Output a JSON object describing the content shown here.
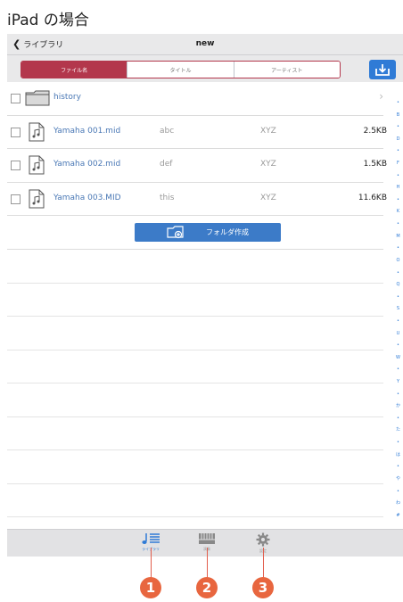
{
  "page": {
    "heading": "iPad の場合"
  },
  "navbar": {
    "back_label": "ライブラリ",
    "title": "new"
  },
  "segments": [
    {
      "label": "ファイル名",
      "selected": true
    },
    {
      "label": "タイトル",
      "selected": false
    },
    {
      "label": "アーティスト",
      "selected": false
    }
  ],
  "list": {
    "folder": {
      "name": "history"
    },
    "files": [
      {
        "name": "Yamaha 001.mid",
        "title": "abc",
        "artist": "XYZ",
        "size": "2.5KB"
      },
      {
        "name": "Yamaha 002.mid",
        "title": "def",
        "artist": "XYZ",
        "size": "1.5KB"
      },
      {
        "name": "Yamaha 003.MID",
        "title": "this",
        "artist": "XYZ",
        "size": "11.6KB"
      }
    ],
    "new_folder_label": "フォルダ作成"
  },
  "index_bar": [
    "•",
    "B",
    "•",
    "D",
    "•",
    "F",
    "•",
    "H",
    "•",
    "K",
    "•",
    "M",
    "•",
    "O",
    "•",
    "Q",
    "•",
    "S",
    "•",
    "U",
    "•",
    "W",
    "•",
    "Y",
    "•",
    "か",
    "•",
    "た",
    "•",
    "は",
    "•",
    "や",
    "•",
    "わ",
    "#"
  ],
  "tabbar": {
    "tabs": [
      {
        "label": "ライブラリ",
        "icon": "library-icon",
        "active": true
      },
      {
        "label": "演奏",
        "icon": "keyboard-icon",
        "active": false
      },
      {
        "label": "設定",
        "icon": "gear-icon",
        "active": false
      }
    ]
  },
  "callouts": [
    "1",
    "2",
    "3"
  ],
  "colors": {
    "accent": "#b3374c",
    "link": "#4a78b5",
    "button": "#3c7bc8",
    "callout": "#e8663f"
  }
}
